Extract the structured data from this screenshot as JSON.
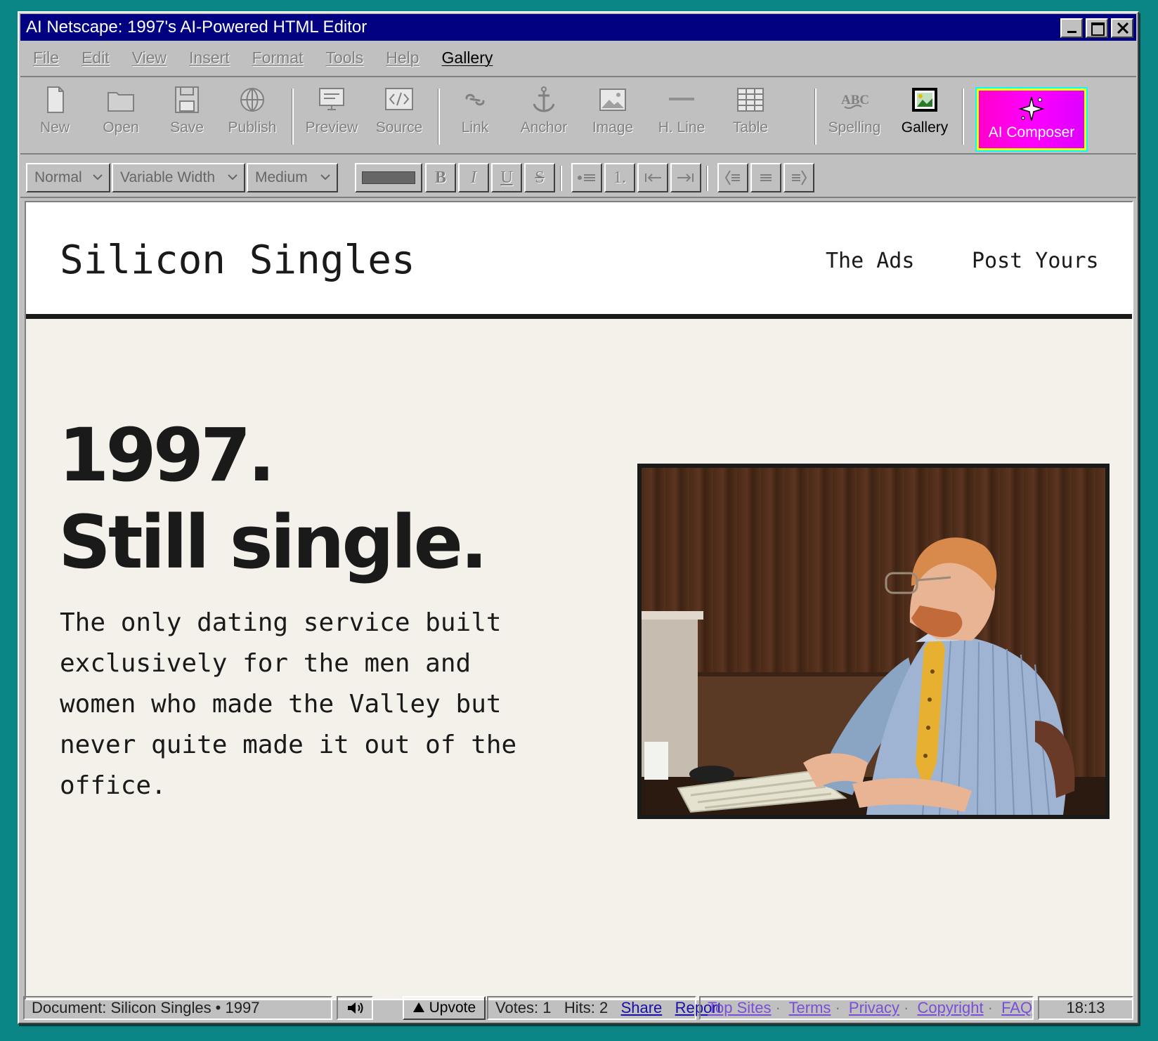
{
  "window": {
    "title": "AI Netscape: 1997's AI-Powered HTML Editor"
  },
  "menu": [
    "File",
    "Edit",
    "View",
    "Insert",
    "Format",
    "Tools",
    "Help",
    "Gallery"
  ],
  "toolbar": {
    "new": "New",
    "open": "Open",
    "save": "Save",
    "publish": "Publish",
    "preview": "Preview",
    "source": "Source",
    "link": "Link",
    "anchor": "Anchor",
    "image": "Image",
    "hline": "H. Line",
    "table": "Table",
    "spelling": "Spelling",
    "gallery": "Gallery",
    "ai_composer": "AI Composer"
  },
  "format": {
    "paragraph_style": "Normal",
    "font": "Variable Width",
    "size": "Medium",
    "bold": "B",
    "italic": "I",
    "underline": "U",
    "strike": "S",
    "ordered_list": "1."
  },
  "page": {
    "site_title": "Silicon Singles",
    "nav": [
      "The Ads",
      "Post Yours"
    ],
    "hero_line1": "1997.",
    "hero_line2": "Still single.",
    "description": "The only dating service built exclusively for the men and women who made the Valley but never quite made it out of the office."
  },
  "status": {
    "document": "Document: Silicon Singles • 1997",
    "upvote": "Upvote",
    "votes": "Votes: 1",
    "hits": "Hits: 2",
    "share": "Share",
    "report": "Report",
    "footer_links": [
      "Top Sites",
      "Terms",
      "Privacy",
      "Copyright",
      "FAQ"
    ],
    "clock": "18:13"
  },
  "colors": {
    "desktop": "#0a8585",
    "titlebar": "#000080",
    "chrome": "#c0c0c0",
    "page_bg": "#f3f1ea",
    "ai_gradient": "#ff00ff"
  }
}
